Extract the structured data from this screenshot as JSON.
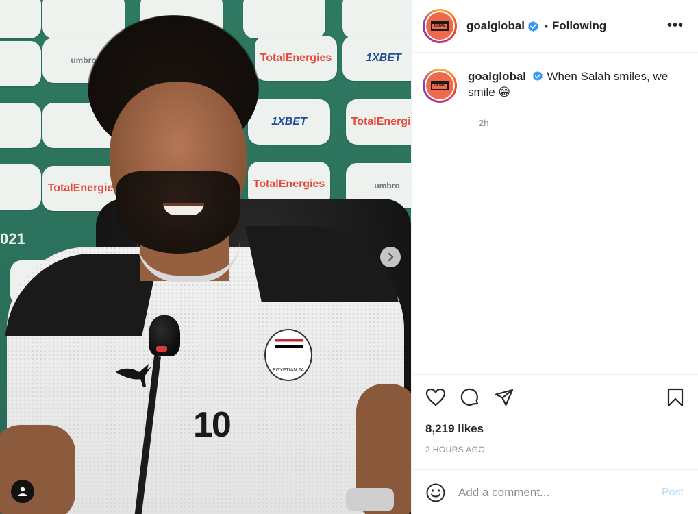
{
  "media": {
    "sponsors": [
      "TotalEnergies",
      "1XBET",
      "umbro"
    ],
    "year_text": "021",
    "shirt_number": "10",
    "crest_text": "EGYPTIAN FA",
    "carousel_next_icon": "chevron-right-icon",
    "tag_icon": "user-icon"
  },
  "header": {
    "avatar_icon": "goal-logo-icon",
    "avatar_text": "GOAL",
    "username": "goalglobal",
    "verified_icon": "verified-badge-icon",
    "separator": "•",
    "follow_status": "Following",
    "more_icon": "more-horizontal-icon",
    "more_label": "•••"
  },
  "caption": {
    "username": "goalglobal",
    "text": "When Salah smiles, we smile 😁",
    "time": "2h"
  },
  "actions": {
    "icons": [
      "heart-icon",
      "comment-icon",
      "share-icon",
      "bookmark-icon"
    ],
    "likes": "8,219 likes",
    "posted_ago": "2 HOURS AGO"
  },
  "comment": {
    "emoji_icon": "smiley-icon",
    "placeholder": "Add a comment...",
    "post_label": "Post"
  },
  "colors": {
    "verified": "#3897f0",
    "post_disabled": "#b2dffc",
    "secondary_text": "#8e8e8e",
    "avatar_bg": "#ee6a4d"
  }
}
